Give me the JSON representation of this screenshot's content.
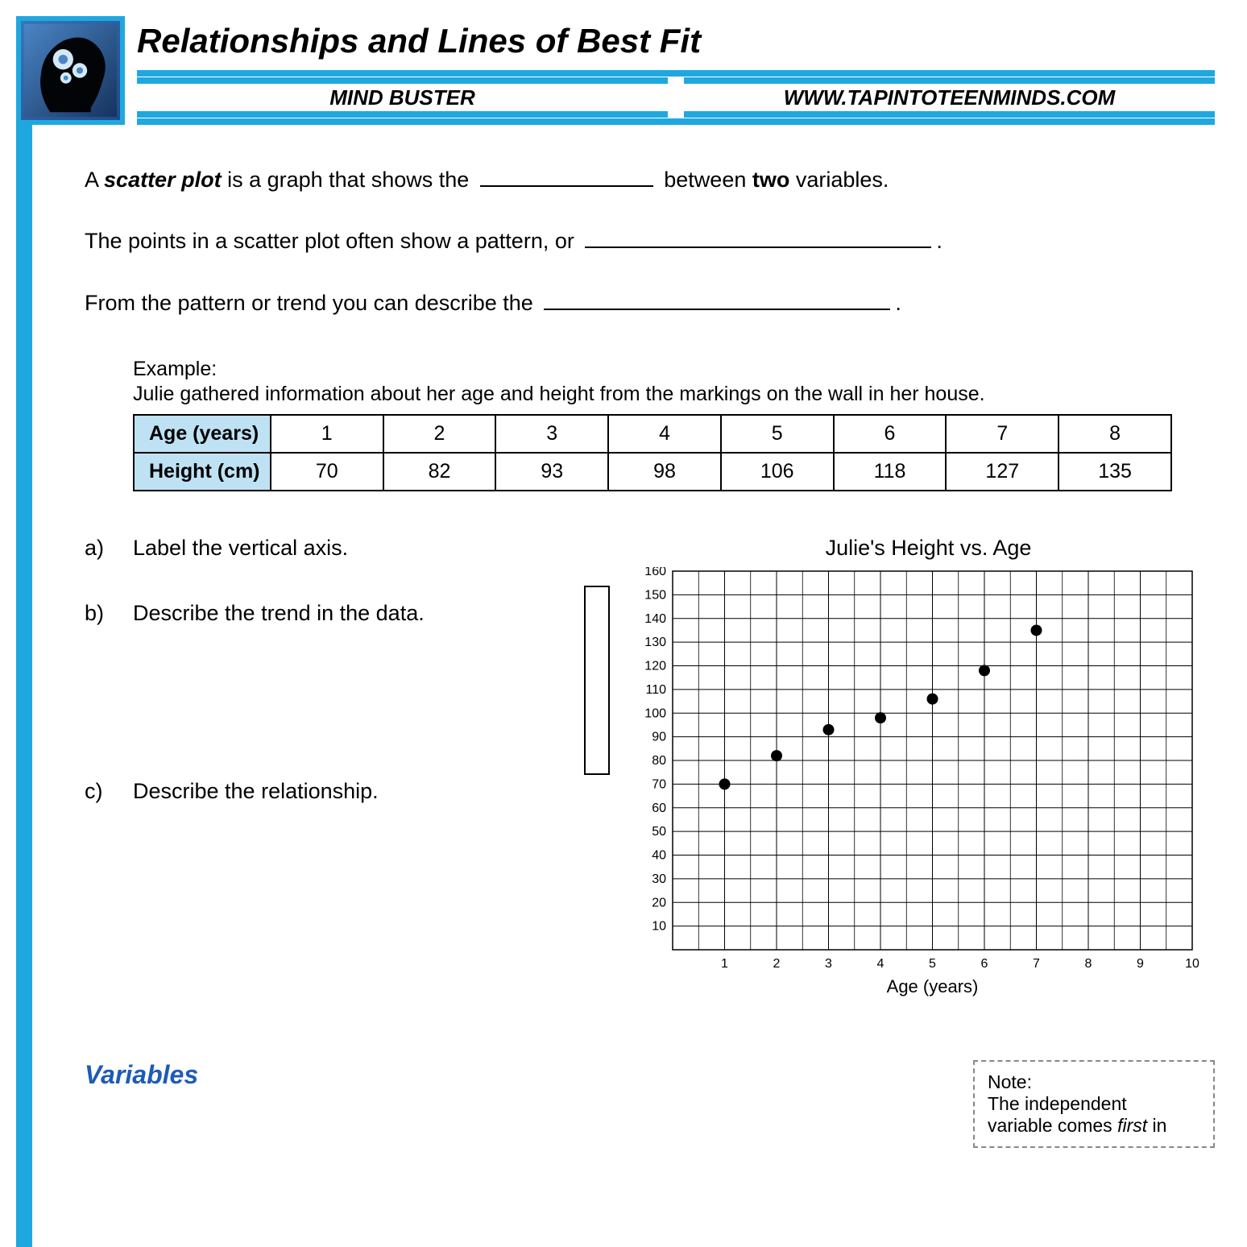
{
  "header": {
    "title": "Relationships and Lines of Best Fit",
    "subtitle_left": "MIND BUSTER",
    "subtitle_right": "WWW.TAPINTOTEENMINDS.COM"
  },
  "intro": {
    "line1_a": "A ",
    "line1_b": "scatter plot",
    "line1_c": " is a graph that shows the ",
    "line1_d": " between ",
    "line1_e": "two",
    "line1_f": " variables.",
    "line2_a": "The points in a scatter plot often show a pattern, or ",
    "line2_b": ".",
    "line3_a": "From the pattern or trend you can describe the ",
    "line3_b": "."
  },
  "example": {
    "label": "Example:",
    "desc": "Julie gathered information about her age and height from the markings on the wall in her house.",
    "row1_label": "Age (years)",
    "row2_label": "Height (cm)",
    "ages": [
      "1",
      "2",
      "3",
      "4",
      "5",
      "6",
      "7",
      "8"
    ],
    "heights": [
      "70",
      "82",
      "93",
      "98",
      "106",
      "118",
      "127",
      "135"
    ]
  },
  "questions": {
    "a_lab": "a)",
    "a_txt": "Label the vertical axis.",
    "b_lab": "b)",
    "b_txt": "Describe the trend in the data.",
    "c_lab": "c)",
    "c_txt": "Describe the relationship."
  },
  "chart": {
    "title": "Julie's Height vs. Age",
    "xlabel": "Age (years)"
  },
  "chart_data": {
    "type": "scatter",
    "title": "Julie's Height vs. Age",
    "xlabel": "Age (years)",
    "ylabel": "",
    "xlim": [
      0,
      10
    ],
    "ylim": [
      0,
      160
    ],
    "x_ticks": [
      1,
      2,
      3,
      4,
      5,
      6,
      7,
      8,
      9,
      10
    ],
    "y_ticks": [
      10,
      20,
      30,
      40,
      50,
      60,
      70,
      80,
      90,
      100,
      110,
      120,
      130,
      140,
      150,
      160
    ],
    "x": [
      1,
      2,
      3,
      4,
      5,
      6,
      7
    ],
    "y": [
      70,
      82,
      93,
      98,
      106,
      118,
      135
    ]
  },
  "bottom": {
    "variables_heading": "Variables",
    "note_label": "Note:",
    "note_line1": "The independent",
    "note_line2_a": "variable comes ",
    "note_line2_b": "first",
    "note_line2_c": " in"
  }
}
